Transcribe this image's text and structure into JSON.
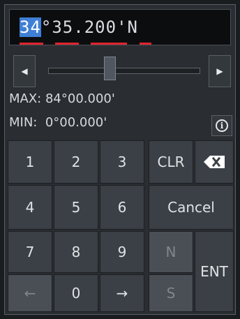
{
  "coordinate": {
    "degrees": "34",
    "degree_symbol": "°",
    "minutes_whole": "35",
    "decimal_point": ".",
    "minutes_fraction": "200",
    "minute_symbol": "'",
    "hemisphere": "N"
  },
  "slider": {
    "left_arrow": "◀",
    "right_arrow": "▶",
    "value_fraction": 0.4
  },
  "limits": {
    "max_label": "MAX:",
    "max_value": "84°00.000'",
    "min_label": "MIN:",
    "min_value": "0°00.000'"
  },
  "info_icon": "i",
  "keypad": {
    "k1": "1",
    "k2": "2",
    "k3": "3",
    "k4": "4",
    "k5": "5",
    "k6": "6",
    "k7": "7",
    "k8": "8",
    "k9": "9",
    "k0": "0",
    "back": "←",
    "forward": "→",
    "clr": "CLR",
    "backspace_icon": "backspace-icon",
    "cancel": "Cancel",
    "north": "N",
    "south": "S",
    "enter": "ENT"
  },
  "colors": {
    "selection": "#3f7fd6",
    "underline": "#e0242e"
  }
}
